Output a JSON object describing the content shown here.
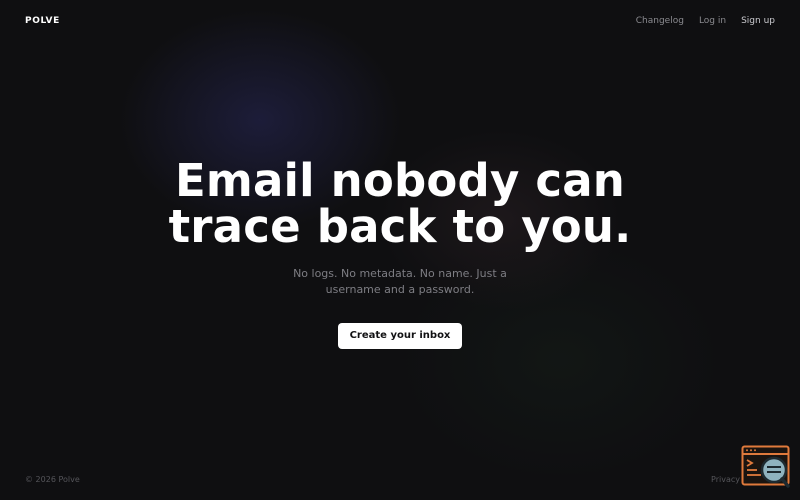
{
  "brand": {
    "name": "POLVE"
  },
  "nav": {
    "changelog": "Changelog",
    "login": "Log in",
    "signup": "Sign up"
  },
  "hero": {
    "title_line1": "Email nobody can",
    "title_line2": "trace back to you.",
    "subtitle": "No logs. No metadata. No name. Just a username and a password.",
    "cta_label": "Create your inbox"
  },
  "footer": {
    "copyright": "© 2026 Polve",
    "privacy": "Privacy"
  },
  "colors": {
    "background": "#0f0f11",
    "accent_widget": "#e07a3c",
    "cta_bg": "#ffffff"
  },
  "icons": {
    "widget": "terminal-search-icon"
  }
}
